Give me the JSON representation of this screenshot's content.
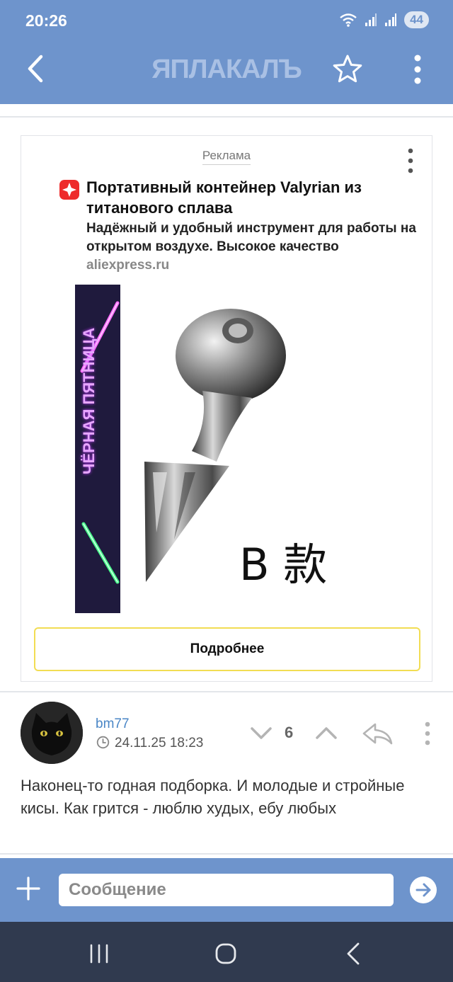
{
  "status_bar": {
    "time": "20:26",
    "battery": "44"
  },
  "app_bar": {
    "logo": "ЯПЛАКАЛЪ",
    "back_icon": "chevron-left-icon",
    "star_icon": "star-outline-icon",
    "menu_icon": "vertical-dots-icon"
  },
  "ad": {
    "label": "Реклама",
    "title": "Портативный контейнер Valyrian из титанового сплава",
    "description": "Надёжный и удобный инструмент для работы на открытом воздухе. Высокое качество",
    "domain": "aliexpress.ru",
    "banner_text": "ЧЁРНАЯ ПЯТНИЦА",
    "product_caption": "B 款",
    "cta": "Подробнее"
  },
  "comment": {
    "author": "bm77",
    "timestamp": "24.11.25 18:23",
    "votes": "6",
    "text": "Наконец-то годная подборка. И молодые и стройные кисы. Как грится - люблю худых, ебу любых"
  },
  "composer": {
    "placeholder": "Сообщение"
  },
  "colors": {
    "bar_blue": "#6e94cc",
    "nav_dark": "#303a4f",
    "cta_border": "#f2dd53",
    "username_blue": "#4a86c6",
    "ali_red": "#ee2b2b"
  }
}
